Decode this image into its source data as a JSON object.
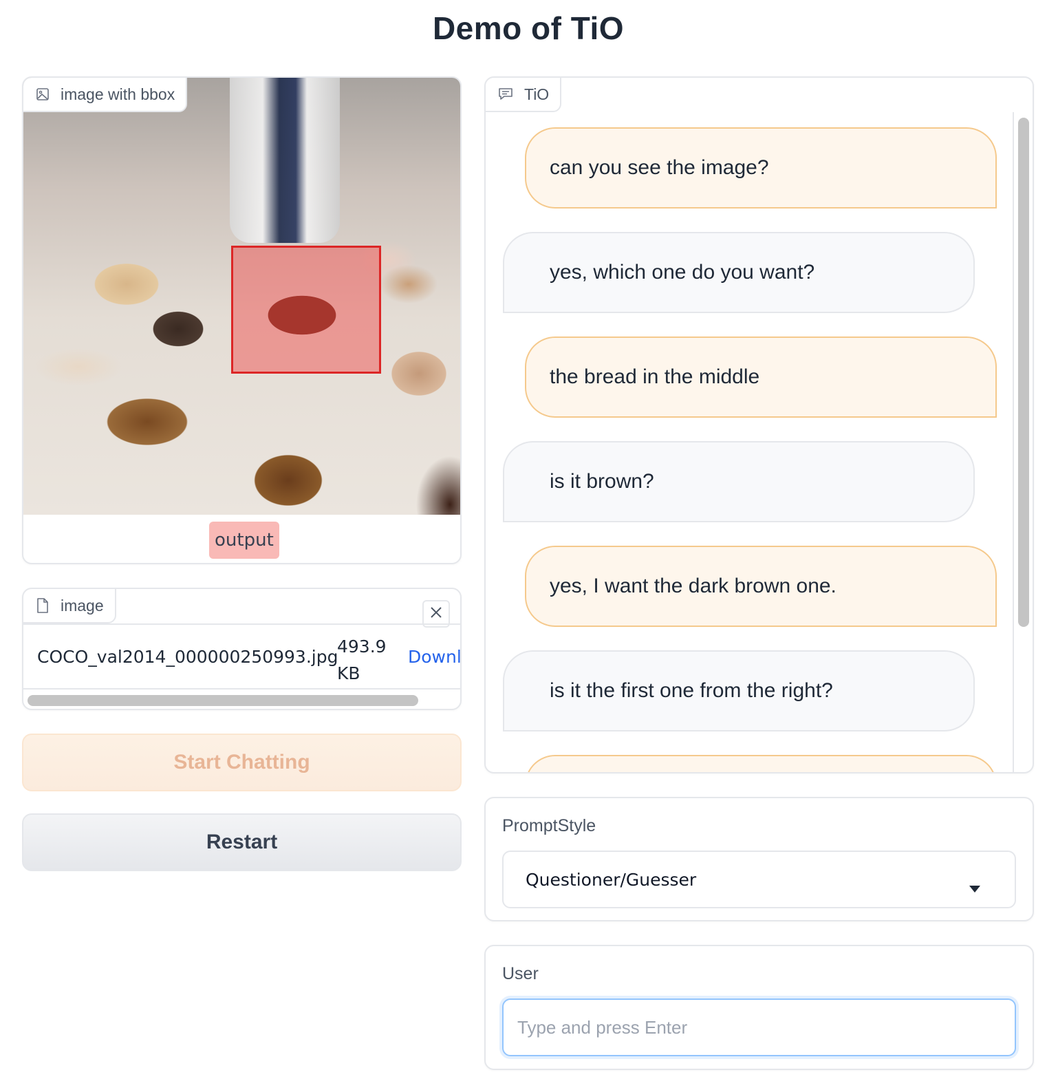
{
  "page": {
    "title": "Demo of TiO"
  },
  "image_output": {
    "label": "image with bbox",
    "tag": "output",
    "icon": "image-icon"
  },
  "file_input": {
    "label": "image",
    "icon": "file-icon",
    "file_name": "COCO_val2014_000000250993.jpg",
    "file_size": "493.9 KB",
    "download_label": "Downl"
  },
  "buttons": {
    "start": "Start Chatting",
    "restart": "Restart"
  },
  "chatbot": {
    "label": "TiO",
    "icon": "chat-icon",
    "messages": [
      {
        "role": "user",
        "text": "can you see the image?"
      },
      {
        "role": "bot",
        "text": "yes, which one do you want?"
      },
      {
        "role": "user",
        "text": "the bread in the middle"
      },
      {
        "role": "bot",
        "text": "is it brown?"
      },
      {
        "role": "user",
        "text": "yes, I want the dark brown one."
      },
      {
        "role": "bot",
        "text": "is it the first one from the right?"
      },
      {
        "role": "user",
        "text": ""
      }
    ]
  },
  "prompt_style": {
    "label": "PromptStyle",
    "selected": "Questioner/Guesser"
  },
  "user_input": {
    "label": "User",
    "placeholder": "Type and press Enter",
    "value": ""
  },
  "colors": {
    "accent_orange": "#f5c98c",
    "bbox_red": "#dc2626",
    "link_blue": "#2563eb"
  }
}
